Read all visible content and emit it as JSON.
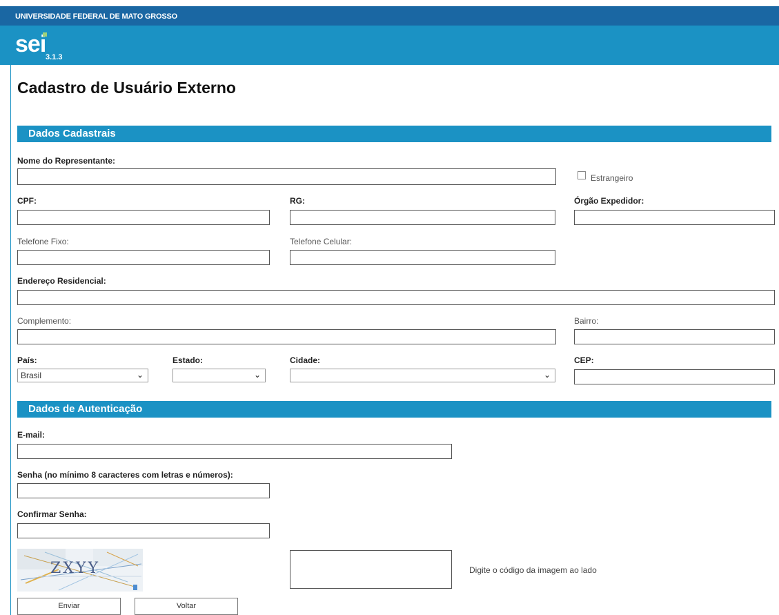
{
  "header": {
    "institution": "UNIVERSIDADE FEDERAL DE MATO GROSSO",
    "logo": "sei",
    "version": "3.1.3"
  },
  "page_title": "Cadastro de Usuário Externo",
  "sections": {
    "cadastrais": "Dados Cadastrais",
    "autenticacao": "Dados de Autenticação"
  },
  "fields": {
    "nome": {
      "label": "Nome do Representante:",
      "value": ""
    },
    "estrangeiro": {
      "label": "Estrangeiro",
      "checked": false
    },
    "cpf": {
      "label": "CPF:",
      "value": ""
    },
    "rg": {
      "label": "RG:",
      "value": ""
    },
    "orgao": {
      "label": "Órgão Expedidor:",
      "value": ""
    },
    "telefone_fixo": {
      "label": "Telefone Fixo:",
      "value": ""
    },
    "telefone_celular": {
      "label": "Telefone Celular:",
      "value": ""
    },
    "endereco": {
      "label": "Endereço Residencial:",
      "value": ""
    },
    "complemento": {
      "label": "Complemento:",
      "value": ""
    },
    "bairro": {
      "label": "Bairro:",
      "value": ""
    },
    "pais": {
      "label": "País:",
      "value": "Brasil"
    },
    "estado": {
      "label": "Estado:",
      "value": ""
    },
    "cidade": {
      "label": "Cidade:",
      "value": ""
    },
    "cep": {
      "label": "CEP:",
      "value": ""
    },
    "email": {
      "label": "E-mail:",
      "value": ""
    },
    "senha": {
      "label": "Senha (no mínimo 8 caracteres com letras e números):",
      "value": ""
    },
    "confirmar_senha": {
      "label": "Confirmar Senha:",
      "value": ""
    }
  },
  "captcha": {
    "text": "ZXYY",
    "hint": "Digite o código da imagem ao lado"
  },
  "buttons": {
    "enviar": "Enviar",
    "voltar": "Voltar"
  }
}
